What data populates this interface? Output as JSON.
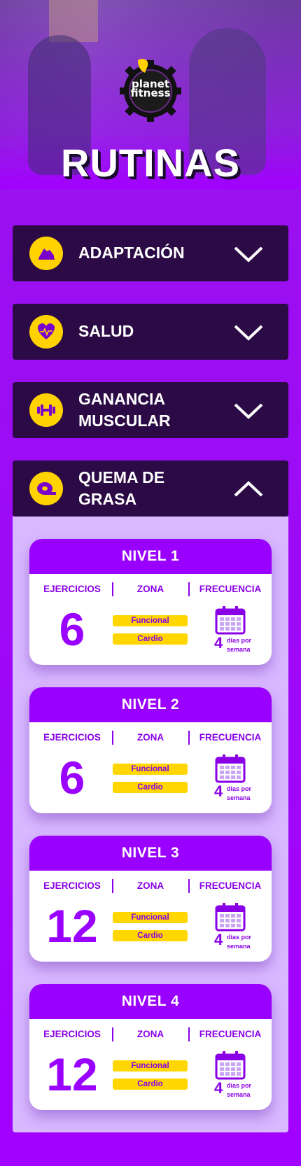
{
  "header": {
    "logo_alt": "planet fitness",
    "logo_line1": "planet",
    "logo_line2": "fitness",
    "title": "RUTINAS"
  },
  "colors": {
    "brand_purple": "#9900ff",
    "dark_bar": "#2b0a45",
    "accent_yellow": "#ffd200",
    "panel_bg": "#d8b8ff"
  },
  "accordion": [
    {
      "label": "ADAPTACIÓN",
      "icon": "running-shoe-icon",
      "expanded": false
    },
    {
      "label": "SALUD",
      "icon": "heart-pulse-icon",
      "expanded": false
    },
    {
      "label_line1": "GANANCIA",
      "label_line2": "MUSCULAR",
      "icon": "dumbbell-icon",
      "expanded": false
    },
    {
      "label_line1": "QUEMA DE",
      "label_line2": "GRASA",
      "icon": "measuring-tape-icon",
      "expanded": true
    }
  ],
  "columns": {
    "exercises": "EJERCICIOS",
    "zone": "ZONA",
    "frequency": "FRECUENCIA"
  },
  "levels": [
    {
      "title": "NIVEL 1",
      "exercises": "6",
      "zones": [
        "Funcional",
        "Cardio"
      ],
      "days": "4",
      "days_text_1": "dias por",
      "days_text_2": "semana"
    },
    {
      "title": "NIVEL 2",
      "exercises": "6",
      "zones": [
        "Funcional",
        "Cardio"
      ],
      "days": "4",
      "days_text_1": "dias por",
      "days_text_2": "semana"
    },
    {
      "title": "NIVEL 3",
      "exercises": "12",
      "zones": [
        "Funcional",
        "Cardio"
      ],
      "days": "4",
      "days_text_1": "dias por",
      "days_text_2": "semana"
    },
    {
      "title": "NIVEL 4",
      "exercises": "12",
      "zones": [
        "Funcional",
        "Cardio"
      ],
      "days": "4",
      "days_text_1": "dias por",
      "days_text_2": "semana"
    }
  ]
}
